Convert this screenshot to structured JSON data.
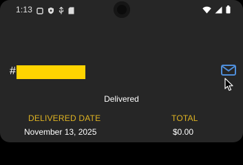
{
  "status_bar": {
    "time": "1:13",
    "left_icons": [
      "screen-icon",
      "shield-icon",
      "usb-icon",
      "sd-card-icon"
    ],
    "right_icons": [
      "wifi-icon",
      "signal-icon",
      "battery-icon"
    ]
  },
  "order": {
    "hash": "#",
    "status": "Delivered",
    "delivered_date_label": "DELIVERED DATE",
    "delivered_date": "November 13, 2025",
    "total_label": "TOTAL",
    "total": "$0.00"
  },
  "colors": {
    "background": "#262626",
    "accent_gold": "#e0b422",
    "redaction": "#ffd400",
    "email_icon": "#4f8fdc"
  }
}
